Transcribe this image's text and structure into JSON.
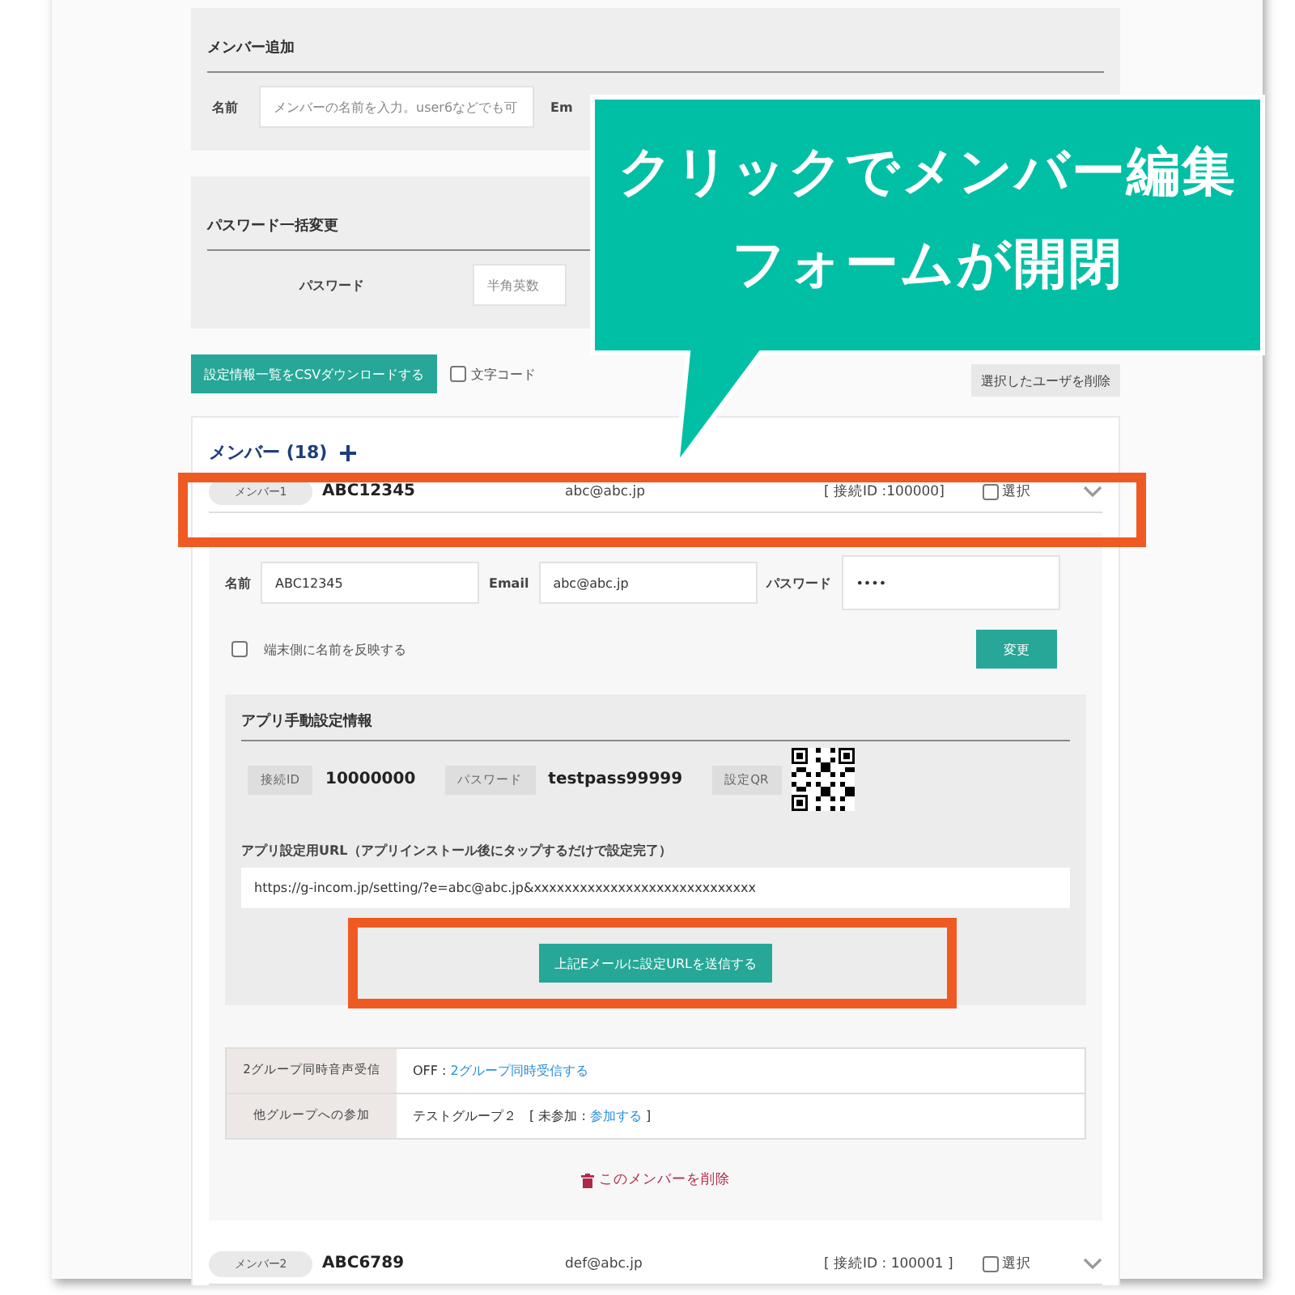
{
  "add_member": {
    "title": "メンバー追加",
    "name_label": "名前",
    "name_placeholder": "メンバーの名前を入力。user6などでも可",
    "email_label": "Em"
  },
  "bulk_password": {
    "title": "パスワード一括変更",
    "label": "パスワード",
    "placeholder": "半角英数"
  },
  "toolbar": {
    "csv_button": "設定情報一覧をCSVダウンロードする",
    "encoding_option": {
      "label": "文字コード",
      "checked": false
    },
    "delete_selected_button": "選択したユーザを削除"
  },
  "members": {
    "heading": "メンバー (18)",
    "list": [
      {
        "badge": "メンバー1",
        "name": "ABC12345",
        "email": "abc@abc.jp",
        "connection_id": "[ 接続ID :100000]",
        "select_label": "選択",
        "selected": false,
        "detail": {
          "fields": [
            {
              "label": "名前",
              "value": "ABC12345"
            },
            {
              "label": "Email",
              "value": "abc@abc.jp"
            },
            {
              "label": "パスワード",
              "value": "••••"
            }
          ],
          "reflect_name": {
            "label": "端末側に名前を反映する",
            "checked": false
          },
          "update_button": "変更",
          "app_settings": {
            "title": "アプリ手動設定情報",
            "items": [
              {
                "kind": "text",
                "label": "接続ID",
                "value": "10000000"
              },
              {
                "kind": "text",
                "label": "パスワード",
                "value": "testpass99999"
              },
              {
                "kind": "qr",
                "label": "設定QR"
              }
            ],
            "url_label": "アプリ設定用URL（アプリインストール後にタップするだけで設定完了）",
            "url": "https://g-incom.jp/setting/?e=abc@abc.jp&xxxxxxxxxxxxxxxxxxxxxxxxxxxxx",
            "send_button": "上記Eメールに設定URLを送信する"
          },
          "options": [
            {
              "label": "2グループ同時音声受信",
              "value": "OFF : ",
              "link": "2グループ同時受信する"
            },
            {
              "label": "他グループへの参加",
              "value": "テストグループ２　[ 未参加 : ",
              "link": "参加する",
              "suffix": " ]"
            }
          ],
          "delete_link": "このメンバーを削除"
        }
      },
      {
        "badge": "メンバー2",
        "name": "ABC6789",
        "email": "def@abc.jp",
        "connection_id": "[ 接続ID : 100001 ]",
        "select_label": "選択",
        "selected": false
      }
    ]
  },
  "callout": {
    "lines": [
      "クリックでメンバー編集",
      "フォームが開閉"
    ]
  }
}
